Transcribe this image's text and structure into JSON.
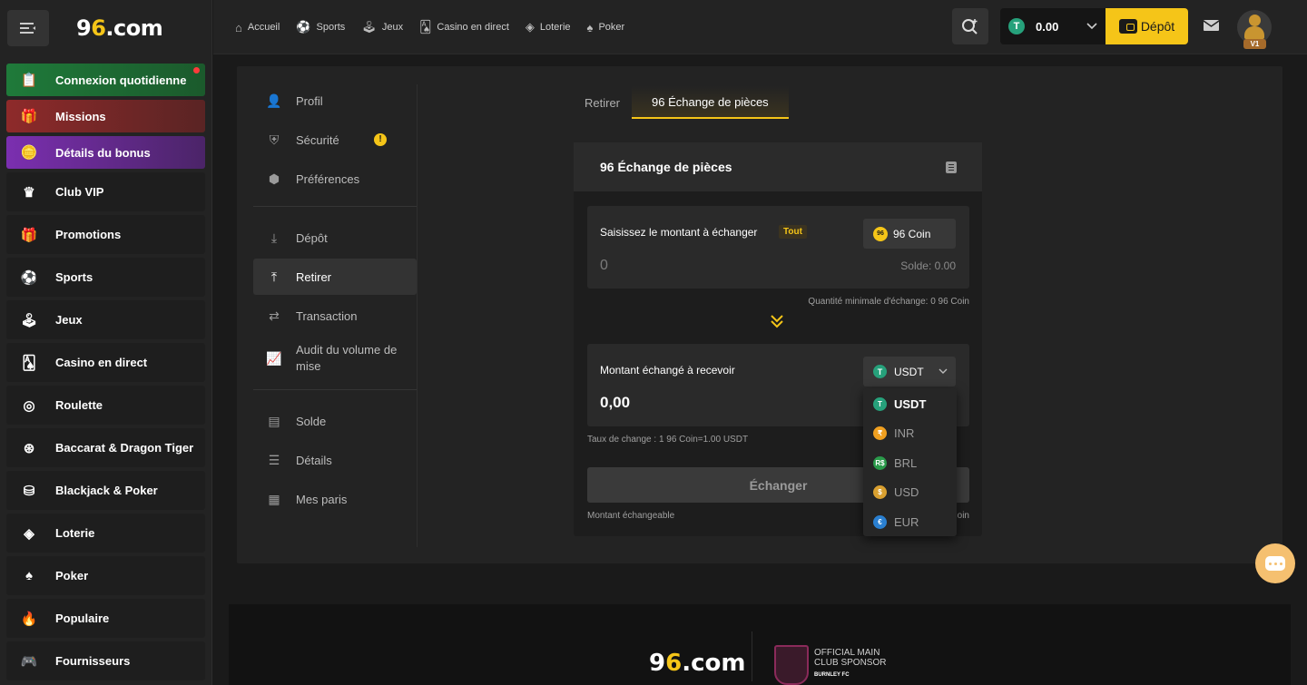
{
  "brand": {
    "logo_pre": "9",
    "logo_y": "6",
    "logo_post": ".com"
  },
  "sidebar": {
    "items": [
      {
        "label": "Connexion quotidienne",
        "icon": "calendar-icon",
        "glyph": "📋"
      },
      {
        "label": "Missions",
        "icon": "gift-icon",
        "glyph": "🎁"
      },
      {
        "label": "Détails du bonus",
        "icon": "coins-icon",
        "glyph": "🪙"
      },
      {
        "label": "Club VIP",
        "icon": "crown-icon",
        "glyph": "♛"
      },
      {
        "label": "Promotions",
        "icon": "present-icon",
        "glyph": "🎁"
      },
      {
        "label": "Sports",
        "icon": "soccer-ball-icon",
        "glyph": "⚽"
      },
      {
        "label": "Jeux",
        "icon": "joystick-icon",
        "glyph": "🕹"
      },
      {
        "label": "Casino en direct",
        "icon": "cards-icon",
        "glyph": "🂡"
      },
      {
        "label": "Roulette",
        "icon": "roulette-icon",
        "glyph": "◎"
      },
      {
        "label": "Baccarat & Dragon Tiger",
        "icon": "globe-chip-icon",
        "glyph": "⊛"
      },
      {
        "label": "Blackjack & Poker",
        "icon": "chip-icon",
        "glyph": "⛁"
      },
      {
        "label": "Loterie",
        "icon": "ticket-icon",
        "glyph": "◈"
      },
      {
        "label": "Poker",
        "icon": "spade-icon",
        "glyph": "♠"
      },
      {
        "label": "Populaire",
        "icon": "fire-icon",
        "glyph": "🔥"
      },
      {
        "label": "Fournisseurs",
        "icon": "gamepad-icon",
        "glyph": "🎮"
      }
    ]
  },
  "topnav": {
    "items": [
      {
        "label": "Accueil",
        "icon": "home-icon",
        "glyph": "⌂"
      },
      {
        "label": "Sports",
        "icon": "soccer-ball-icon",
        "glyph": "⚽"
      },
      {
        "label": "Jeux",
        "icon": "joystick-icon",
        "glyph": "🕹"
      },
      {
        "label": "Casino en direct",
        "icon": "cards-icon",
        "glyph": "🂡"
      },
      {
        "label": "Loterie",
        "icon": "ticket-icon",
        "glyph": "◈"
      },
      {
        "label": "Poker",
        "icon": "spade-icon",
        "glyph": "♠"
      }
    ],
    "balance": "0.00",
    "deposit_label": "Dépôt",
    "vip_level": "V1"
  },
  "account_nav": {
    "group1": [
      {
        "label": "Profil",
        "icon": "user-icon",
        "glyph": "👤"
      },
      {
        "label": "Sécurité",
        "icon": "shield-icon",
        "glyph": "⛨",
        "warning": "!"
      },
      {
        "label": "Préférences",
        "icon": "settings-icon",
        "glyph": "⬢"
      }
    ],
    "group2": [
      {
        "label": "Dépôt",
        "icon": "download-tray-icon",
        "glyph": "⤓"
      },
      {
        "label": "Retirer",
        "icon": "upload-tray-icon",
        "glyph": "⤒"
      },
      {
        "label": "Transaction",
        "icon": "transfer-icon",
        "glyph": "⇄"
      },
      {
        "label": "Audit du volume de mise",
        "icon": "chart-icon",
        "glyph": "📈"
      }
    ],
    "group3": [
      {
        "label": "Solde",
        "icon": "wallet-icon",
        "glyph": "▤"
      },
      {
        "label": "Détails",
        "icon": "list-icon",
        "glyph": "☰"
      },
      {
        "label": "Mes paris",
        "icon": "receipt-icon",
        "glyph": "▦"
      }
    ]
  },
  "tabs": [
    "Retirer",
    "96 Échange de pièces"
  ],
  "exchange": {
    "title": "96 Échange de pièces",
    "input_label": "Saisissez le montant à échanger",
    "all_label": "Tout",
    "coin_label": "96 Coin",
    "amount_placeholder": "0",
    "balance_text": "Solde: 0.00",
    "min_note": "Quantité minimale d'échange: 0 96 Coin",
    "receive_label": "Montant échangé à recevoir",
    "currency_selected": "USDT",
    "received_amount": "0,00",
    "rate_text": "Taux de change : 1 96 Coin=1.00 USDT",
    "button_label": "Échanger",
    "exchangeable_label": "Montant échangeable",
    "exchangeable_suffix": "oin"
  },
  "currency_options": [
    {
      "code": "USDT",
      "glyph": "T",
      "color": "#26a17b"
    },
    {
      "code": "INR",
      "glyph": "₹",
      "color": "#f0a020"
    },
    {
      "code": "BRL",
      "glyph": "R$",
      "color": "#2a9a4a"
    },
    {
      "code": "USD",
      "glyph": "$",
      "color": "#d9a030"
    },
    {
      "code": "EUR",
      "glyph": "€",
      "color": "#2a7fd0"
    }
  ],
  "footer": {
    "sponsor_line1": "OFFICIAL MAIN",
    "sponsor_line2": "CLUB SPONSOR",
    "sponsor_club": "BURNLEY FC"
  },
  "colors": {
    "accent": "#f5c518",
    "bg": "#1a1a1a",
    "panel": "#232323"
  }
}
